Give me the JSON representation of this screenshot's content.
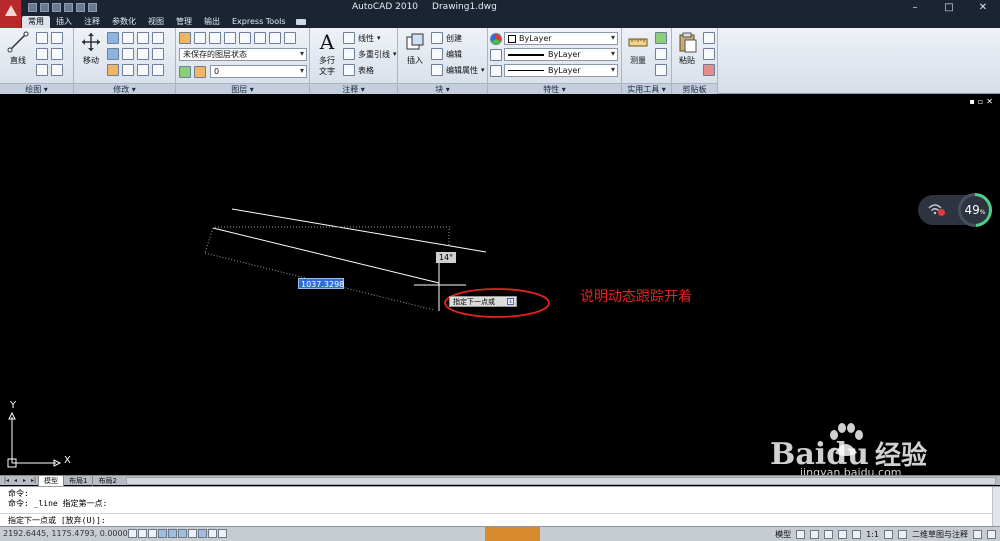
{
  "app": {
    "name": "AutoCAD 2010",
    "document": "Drawing1.dwg"
  },
  "ribbon_tabs": [
    {
      "label": "常用",
      "active": true
    },
    {
      "label": "插入"
    },
    {
      "label": "注释"
    },
    {
      "label": "参数化"
    },
    {
      "label": "视图"
    },
    {
      "label": "管理"
    },
    {
      "label": "输出"
    },
    {
      "label": "Express Tools"
    }
  ],
  "panels": {
    "draw": {
      "title": "绘图",
      "line_label": "直线"
    },
    "modify": {
      "title": "修改",
      "move_label": "移动"
    },
    "layers": {
      "title": "图层",
      "layer_state": "未保存的图层状态",
      "current_layer": "0"
    },
    "annotation": {
      "title": "注释",
      "mtext_label_1": "多行",
      "mtext_label_2": "文字",
      "linear": "线性",
      "mleader": "多重引线",
      "table": "表格"
    },
    "block": {
      "title": "块",
      "insert": "插入",
      "create": "创建",
      "edit": "编辑",
      "edit_attr": "编辑属性"
    },
    "properties": {
      "title": "特性",
      "color": "ByLayer",
      "linetype": "ByLayer",
      "lineweight": "ByLayer"
    },
    "utilities": {
      "title": "实用工具",
      "measure": "测量"
    },
    "clipboard": {
      "title": "剪贴板",
      "paste": "粘贴"
    }
  },
  "canvas": {
    "dim_input_value": "1037.3298",
    "angle_value": "14°",
    "prompt_text": "指定下一点或",
    "annotation_note": "说明动态跟踪开着",
    "axis_x": "X",
    "axis_y": "Y",
    "speed_percent": "49",
    "speed_unit": "%"
  },
  "watermark": {
    "brand": "Baidu",
    "cn": "经验",
    "url": "jingyan.baidu.com"
  },
  "layout_tabs": [
    {
      "label": "模型",
      "active": true
    },
    {
      "label": "布局1"
    },
    {
      "label": "布局2"
    }
  ],
  "command_line": {
    "history": [
      "命令:",
      "命令: _line 指定第一点:"
    ],
    "current": "指定下一点或 [放弃(U)]:"
  },
  "status_bar": {
    "coords": "2192.6445, 1175.4793, 0.0000",
    "model_label": "模型",
    "scale": "1:1",
    "workspace": "二维草图与注释"
  },
  "colors": {
    "note_red": "#e3231f",
    "dim_input_blue": "#2f6fd3",
    "canvas_bg": "#000000",
    "gauge_green": "#4fd08a"
  }
}
